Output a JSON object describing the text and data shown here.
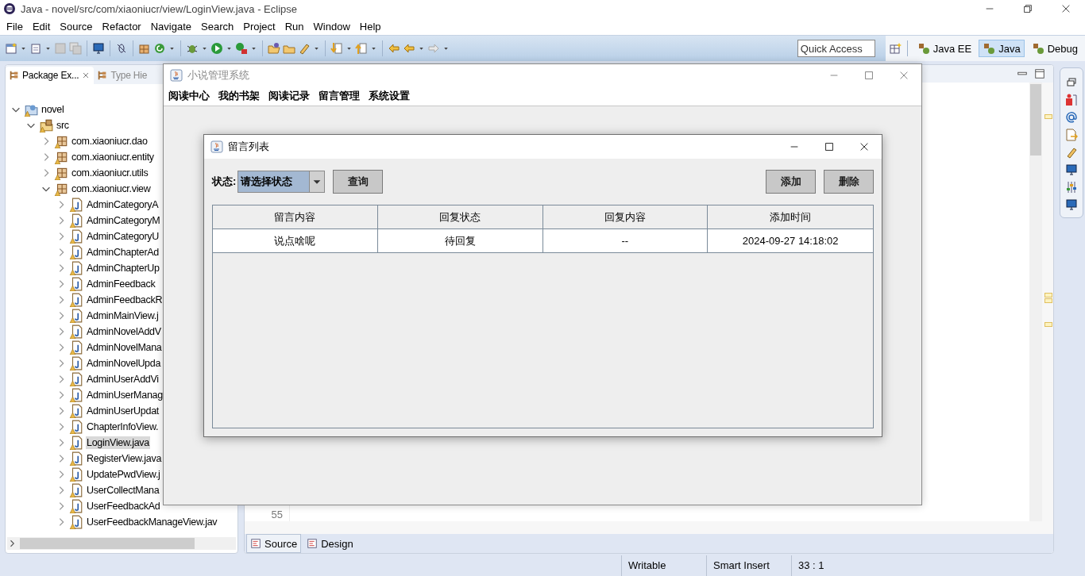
{
  "eclipse": {
    "title": "Java - novel/src/com/xiaoniucr/view/LoginView.java - Eclipse",
    "menu": [
      "File",
      "Edit",
      "Source",
      "Refactor",
      "Navigate",
      "Search",
      "Project",
      "Run",
      "Window",
      "Help"
    ],
    "quick_access": {
      "placeholder": "Quick Access"
    },
    "perspectives": [
      {
        "label": "Java EE",
        "selected": false
      },
      {
        "label": "Java",
        "selected": true
      },
      {
        "label": "Debug",
        "selected": false
      }
    ]
  },
  "package_explorer": {
    "tabs": [
      {
        "label": "Package Ex...",
        "selected": true
      },
      {
        "label": "Type Hie",
        "selected": false
      }
    ],
    "tree": [
      {
        "label": "novel",
        "kind": "project",
        "expanded": true,
        "selected": false,
        "children": [
          {
            "label": "src",
            "kind": "source_folder",
            "expanded": true,
            "selected": false,
            "children": [
              {
                "label": "com.xiaoniucr.dao",
                "kind": "package",
                "expanded": false,
                "selected": false
              },
              {
                "label": "com.xiaoniucr.entity",
                "kind": "package",
                "expanded": false,
                "selected": false
              },
              {
                "label": "com.xiaoniucr.utils",
                "kind": "package",
                "expanded": false,
                "selected": false
              },
              {
                "label": "com.xiaoniucr.view",
                "kind": "package",
                "expanded": true,
                "selected": false,
                "children": [
                  {
                    "label": "AdminCategoryA",
                    "kind": "java_file",
                    "expanded": false,
                    "selected": false
                  },
                  {
                    "label": "AdminCategoryM",
                    "kind": "java_file",
                    "expanded": false,
                    "selected": false
                  },
                  {
                    "label": "AdminCategoryU",
                    "kind": "java_file",
                    "expanded": false,
                    "selected": false
                  },
                  {
                    "label": "AdminChapterAd",
                    "kind": "java_file",
                    "expanded": false,
                    "selected": false
                  },
                  {
                    "label": "AdminChapterUp",
                    "kind": "java_file",
                    "expanded": false,
                    "selected": false
                  },
                  {
                    "label": "AdminFeedback",
                    "kind": "java_file",
                    "expanded": false,
                    "selected": false
                  },
                  {
                    "label": "AdminFeedbackR",
                    "kind": "java_file",
                    "expanded": false,
                    "selected": false
                  },
                  {
                    "label": "AdminMainView.j",
                    "kind": "java_file",
                    "expanded": false,
                    "selected": false
                  },
                  {
                    "label": "AdminNovelAddV",
                    "kind": "java_file",
                    "expanded": false,
                    "selected": false
                  },
                  {
                    "label": "AdminNovelMana",
                    "kind": "java_file",
                    "expanded": false,
                    "selected": false
                  },
                  {
                    "label": "AdminNovelUpda",
                    "kind": "java_file",
                    "expanded": false,
                    "selected": false
                  },
                  {
                    "label": "AdminUserAddVi",
                    "kind": "java_file",
                    "expanded": false,
                    "selected": false
                  },
                  {
                    "label": "AdminUserManag",
                    "kind": "java_file",
                    "expanded": false,
                    "selected": false
                  },
                  {
                    "label": "AdminUserUpdat",
                    "kind": "java_file",
                    "expanded": false,
                    "selected": false
                  },
                  {
                    "label": "ChapterInfoView.",
                    "kind": "java_file",
                    "expanded": false,
                    "selected": false
                  },
                  {
                    "label": "LoginView.java",
                    "kind": "java_file",
                    "expanded": false,
                    "selected": true
                  },
                  {
                    "label": "RegisterView.java",
                    "kind": "java_file",
                    "expanded": false,
                    "selected": false
                  },
                  {
                    "label": "UpdatePwdView.j",
                    "kind": "java_file",
                    "expanded": false,
                    "selected": false
                  },
                  {
                    "label": "UserCollectMana",
                    "kind": "java_file",
                    "expanded": false,
                    "selected": false
                  },
                  {
                    "label": "UserFeedbackAd",
                    "kind": "java_file",
                    "expanded": false,
                    "selected": false
                  },
                  {
                    "label": "UserFeedbackManageView.jav",
                    "kind": "java_file",
                    "expanded": false,
                    "selected": false
                  }
                ]
              }
            ]
          }
        ]
      }
    ]
  },
  "editor": {
    "line_number": "55",
    "tabs": [
      {
        "label": "Source",
        "selected": true
      },
      {
        "label": "Design",
        "selected": false
      }
    ]
  },
  "status_bar": [
    "Writable",
    "Smart Insert",
    "33 : 1"
  ],
  "app_window": {
    "title": "小说管理系统",
    "menu": [
      "阅读中心",
      "我的书架",
      "阅读记录",
      "留言管理",
      "系统设置"
    ]
  },
  "dialog": {
    "title": "留言列表",
    "filter": {
      "label": "状态:",
      "value": "请选择状态"
    },
    "query_button": "查询",
    "add_button": "添加",
    "delete_button": "删除",
    "table": {
      "columns": [
        "留言内容",
        "回复状态",
        "回复内容",
        "添加时间"
      ],
      "rows": [
        [
          "说点啥呢",
          "待回复",
          "--",
          "2024-09-27 14:18:02"
        ]
      ]
    }
  }
}
